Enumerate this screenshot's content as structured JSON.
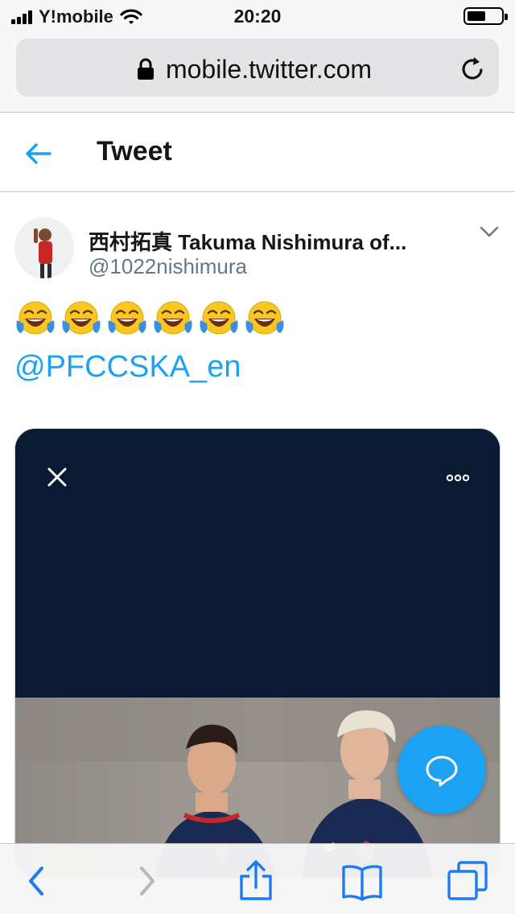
{
  "status_bar": {
    "carrier": "Y!mobile",
    "time": "20:20"
  },
  "browser": {
    "url": "mobile.twitter.com"
  },
  "header": {
    "title": "Tweet"
  },
  "tweet": {
    "author_name": "西村拓真 Takuma Nishimura of...",
    "author_handle": "@1022nishimura",
    "emojis": [
      "😂",
      "😂",
      "😂",
      "😂",
      "😂",
      "😂"
    ],
    "mention": "@PFCCSKA_en"
  },
  "colors": {
    "accent": "#1da1f2",
    "media_background": "#0b1a33",
    "handle_gray": "#657786"
  },
  "icons": {
    "status": [
      "signal-icon",
      "wifi-icon",
      "battery-icon"
    ],
    "browser": [
      "lock-icon",
      "reload-icon"
    ],
    "header": [
      "back-arrow-icon"
    ],
    "media": [
      "close-icon",
      "more-icon"
    ],
    "fab": [
      "reply-bubble-icon"
    ],
    "toolbar": [
      "back-icon",
      "forward-icon",
      "share-icon",
      "bookmarks-icon",
      "tabs-icon"
    ]
  }
}
